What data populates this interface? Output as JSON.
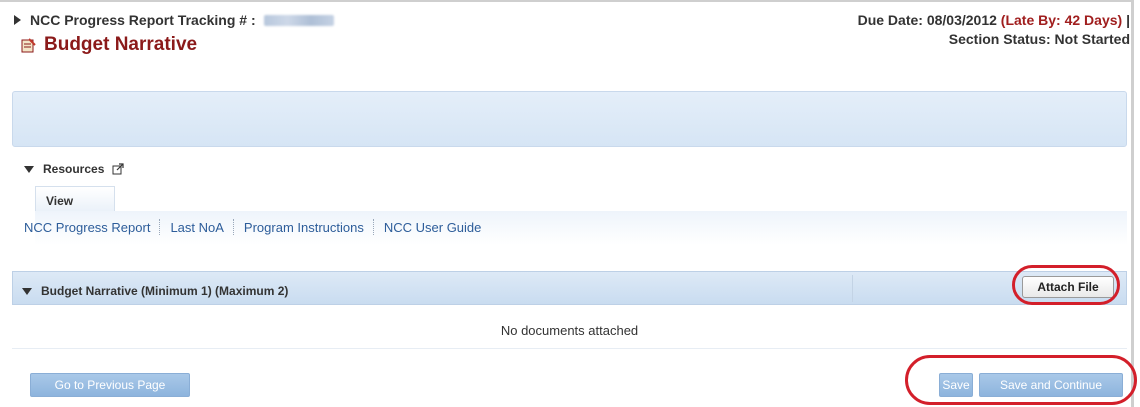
{
  "page": {
    "title": "Budget Narrative",
    "title_icon": "notepad-icon"
  },
  "tracking": {
    "label": "NCC Progress Report Tracking # :",
    "due_date": "Due Date: 08/03/2012",
    "late_by": "(Late By: 42 Days)",
    "separator": "|",
    "section_status": "Section Status: Not Started"
  },
  "resources": {
    "label": "Resources",
    "view_tab": "View",
    "links": [
      "NCC Progress Report",
      "Last NoA",
      "Program Instructions",
      "NCC User Guide"
    ]
  },
  "documents": {
    "header": "Budget Narrative (Minimum 1) (Maximum 2)",
    "attach_label": "Attach File",
    "empty_message": "No documents attached"
  },
  "footer": {
    "prev_label": "Go to Previous Page",
    "save_label": "Save",
    "save_continue_label": "Save and Continue"
  },
  "colors": {
    "title": "#8b1a1a",
    "late": "#a01e1e",
    "link": "#2d5d9a",
    "annotation_circle": "#d31f2a",
    "button": "#9fc0e3"
  }
}
